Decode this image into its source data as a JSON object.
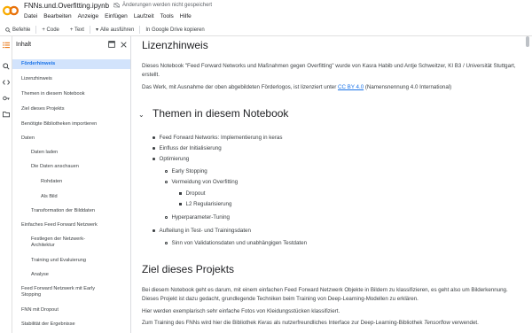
{
  "app": {
    "filename": "FNNs.und.Overfitting.ipynb",
    "save_status": "Änderungen werden nicht gespeichert",
    "menus": [
      "Datei",
      "Bearbeiten",
      "Anzeige",
      "Einfügen",
      "Laufzeit",
      "Tools",
      "Hilfe"
    ]
  },
  "toolbar": {
    "commands": "Befehle",
    "code": "+ Code",
    "text": "+ Text",
    "run_all": "Alle ausführen",
    "copy_drive": "In Google Drive kopieren"
  },
  "sidebar": {
    "title": "Inhalt",
    "items": [
      {
        "label": "Förderhinweis",
        "level": 1,
        "active": true
      },
      {
        "label": "Lizenzhinweis",
        "level": 1
      },
      {
        "label": "Themen in diesem Notebook",
        "level": 1
      },
      {
        "label": "Ziel dieses Projekts",
        "level": 1
      },
      {
        "label": "Benötigte Bibliotheken importieren",
        "level": 1
      },
      {
        "label": "Daten",
        "level": 1
      },
      {
        "label": "Daten laden",
        "level": 2
      },
      {
        "label": "Die Daten anschauen",
        "level": 2
      },
      {
        "label": "Rohdaten",
        "level": 3
      },
      {
        "label": "Als Bild",
        "level": 3
      },
      {
        "label": "Transformation der Bilddaten",
        "level": 2
      },
      {
        "label": "Einfaches Feed Forward Netzwerk",
        "level": 1
      },
      {
        "label": "Festlegen der Netzwerk-",
        "label2": "Architektur",
        "level": 2
      },
      {
        "label": "Training und Evaluierung",
        "level": 2
      },
      {
        "label": "Analyse",
        "level": 2
      },
      {
        "label": "Feed Forward Netzwerk mit Early",
        "label2": "Stopping",
        "level": 1
      },
      {
        "label": "FNN mit Dropout",
        "level": 1
      },
      {
        "label": "Stabilität der Ergebnisse",
        "level": 1
      }
    ]
  },
  "content": {
    "license_heading": "Lizenzhinweis",
    "license_p1": "Dieses Notebook \"Feed Forward Networks und Maßnahmen gegen Overfitting\" wurde von Kasra Habib und Antje Schweitzer, KI B3 / Universität Stuttgart, erstellt.",
    "license_p2_a": "Das Werk, mit Ausnahme der oben abgebildeten Förderlogos, ist lizenziert unter ",
    "license_link": "CC BY 4.0",
    "license_p2_b": " (Namensnennung 4.0 International)",
    "topics_heading": "Themen in diesem Notebook",
    "topics": [
      {
        "text": "Feed Forward Networks: Implementierung in keras",
        "level": 1
      },
      {
        "text": "Einfluss der Initialisierung",
        "level": 1
      },
      {
        "text": "Optimierung",
        "level": 1
      },
      {
        "text": "Early Stopping",
        "level": 2
      },
      {
        "text": "Vermeidung von Overfitting",
        "level": 2
      },
      {
        "text": "Dropout",
        "level": 3
      },
      {
        "text": "L2 Regularisierung",
        "level": 3
      },
      {
        "text": "Hyperparameter-Tuning",
        "level": 2
      },
      {
        "text": "Aufteilung in Test- und Trainingsdaten",
        "level": 1
      },
      {
        "text": "Sinn von Validationsdaten und unabhängigen Testdaten",
        "level": 2
      }
    ],
    "goal_heading": "Ziel dieses Projekts",
    "goal_p1": "Bei diesem Notebook geht es darum, mit einem einfachen Feed Forward Netzwerk Objekte in Bildern zu klassifizieren, es geht also um Bilderkennung. Dieses Projekt ist dazu gedacht, grundlegende Techniken beim Training von Deep-Learning-Modellen zu erklären.",
    "goal_p2": "Hier werden exemplarisch sehr einfache Fotos von Kleidungsstücken klassifiziert.",
    "goal_p3_a": "Zum Training des FNNs wird hier die Bibliothek ",
    "goal_p3_keras": "Keras",
    "goal_p3_b": " als nutzerfreundliches Interface zur Deep-Learning-Bibliothek ",
    "goal_p3_tf": "Tensorflow",
    "goal_p3_c": " verwendet."
  }
}
